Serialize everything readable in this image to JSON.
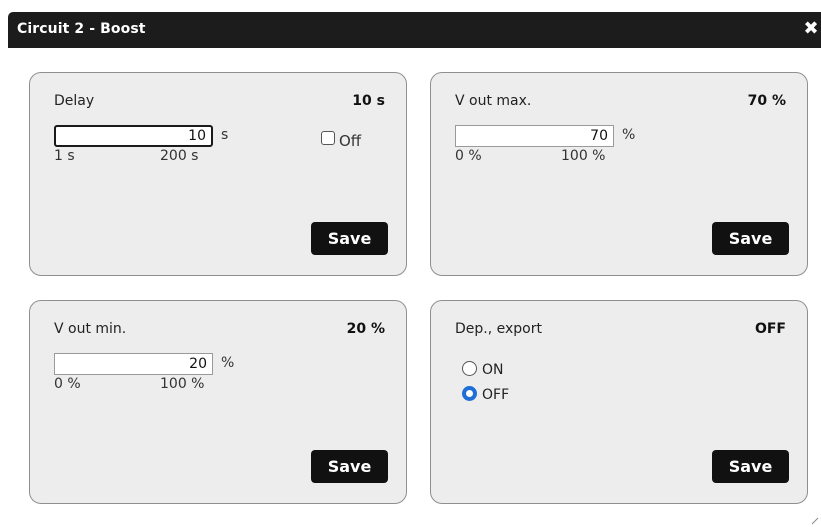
{
  "dialog": {
    "title": "Circuit 2 - Boost",
    "close_glyph": "✖"
  },
  "panels": {
    "delay": {
      "label": "Delay",
      "value": "10 s",
      "input_value": "10",
      "unit": "s",
      "min_label": "1 s",
      "max_label": "200 s",
      "off_label": "Off",
      "off_checked": false,
      "save_label": "Save"
    },
    "vmax": {
      "label": "V out max.",
      "value": "70 %",
      "input_value": "70",
      "unit": "%",
      "min_label": "0 %",
      "max_label": "100 %",
      "save_label": "Save"
    },
    "vmin": {
      "label": "V out min.",
      "value": "20 %",
      "input_value": "20",
      "unit": "%",
      "min_label": "0 %",
      "max_label": "100 %",
      "save_label": "Save"
    },
    "export": {
      "label": "Dep., export",
      "value": "OFF",
      "options": [
        {
          "label": "ON",
          "checked": false
        },
        {
          "label": "OFF",
          "checked": true
        }
      ],
      "save_label": "Save"
    }
  },
  "colors": {
    "titlebar": "#1c1c1c",
    "panel_bg": "#ededed",
    "button_bg": "#111111",
    "radio_selected": "#1f6fd6"
  },
  "icons": {
    "close": "close-icon",
    "resize": "resize-grip-icon"
  }
}
